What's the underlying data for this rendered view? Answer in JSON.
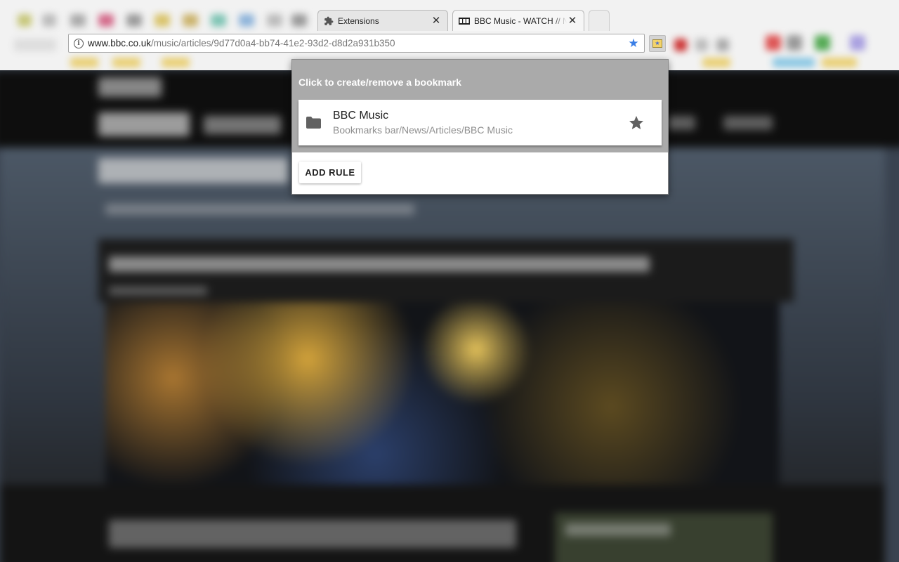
{
  "tabs": [
    {
      "title": "Extensions",
      "icon": "puzzle-icon",
      "active": false
    },
    {
      "title": "BBC Music - WATCH // N",
      "icon": "bbc-favicon",
      "active": true
    }
  ],
  "omnibox": {
    "host": "www.bbc.co.uk",
    "path": "/music/articles/9d77d0a4-bb74-41e2-93d2-d8d2a931b350",
    "bookmarked": true
  },
  "extension_button": {
    "icon": "bookmark-rules-icon"
  },
  "popup": {
    "header": "Click to create/remove a bookmark",
    "bookmark": {
      "name": "BBC Music",
      "path": "Bookmarks bar/News/Articles/BBC Music",
      "icon": "folder-icon",
      "starred": true
    },
    "add_rule_label": "ADD RULE"
  },
  "colors": {
    "popup_header": "#aaaaaa",
    "star_blue": "#3b7fe6",
    "icon_gray": "#616161"
  }
}
